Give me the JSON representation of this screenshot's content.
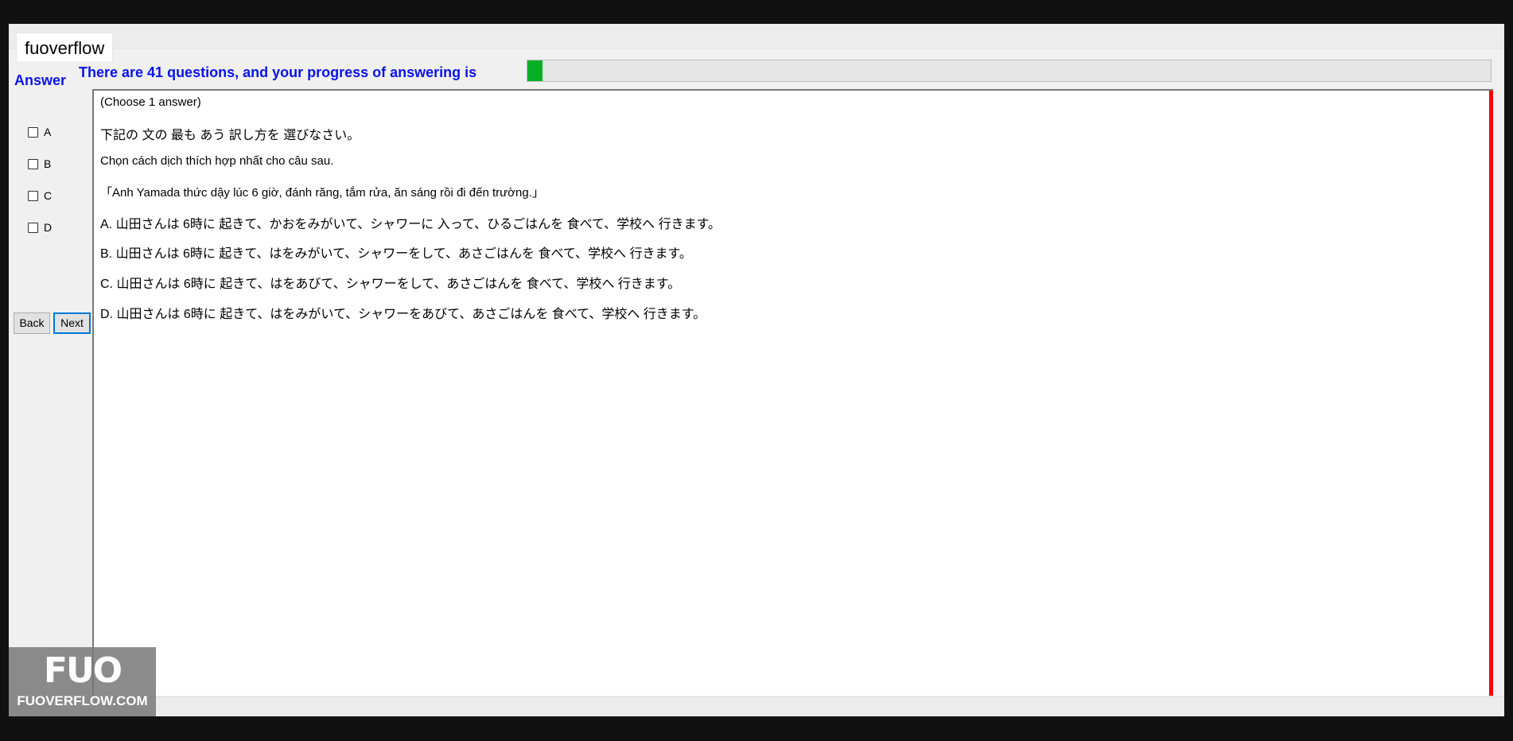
{
  "tab": {
    "title": "fuoverflow"
  },
  "progress": {
    "label": "There are 41 questions, and your progress of answering is",
    "fraction": 0.016,
    "fill_color": "#06b025"
  },
  "answer_panel": {
    "heading": "Answer",
    "options": [
      {
        "label": "A",
        "checked": false
      },
      {
        "label": "B",
        "checked": false
      },
      {
        "label": "C",
        "checked": false
      },
      {
        "label": "D",
        "checked": false
      }
    ]
  },
  "nav": {
    "back_label": "Back",
    "next_label": "Next"
  },
  "question": {
    "instruction": "(Choose 1 answer)",
    "prompt_jp": "下記の 文の 最も あう 訳し方を 選びなさい。",
    "prompt_vi": "Chọn cách dịch thích hợp nhất cho câu sau.",
    "sentence": "「Anh Yamada thức dậy lúc 6 giờ, đánh răng, tắm rửa, ăn sáng rồi đi đến trường.」",
    "choices": [
      "A.  山田さんは 6時に 起きて、かおをみがいて、シャワーに 入って、ひるごはんを 食べて、学校へ 行きます。",
      "B.  山田さんは 6時に 起きて、はをみがいて、シャワーをして、あさごはんを 食べて、学校へ 行きます。",
      "C.  山田さんは 6時に 起きて、はをあびて、シャワーをして、あさごはんを 食べて、学校へ 行きます。",
      "D.  山田さんは 6時に 起きて、はをみがいて、シャワーをあびて、あさごはんを 食べて、学校へ 行きます。"
    ]
  },
  "watermark": {
    "mark": "FUO",
    "url": "FUOVERFLOW.COM"
  },
  "colors": {
    "accent_blue": "#0a14e6",
    "scroll_marker": "#ff0000"
  }
}
